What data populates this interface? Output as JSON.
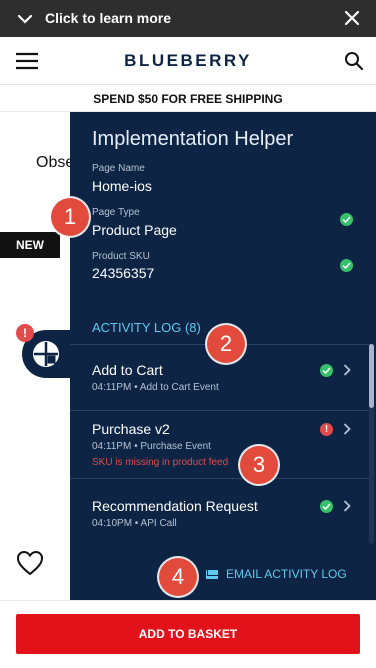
{
  "banner": {
    "text": "Click to learn more"
  },
  "header": {
    "brand": "BLUEBERRY"
  },
  "promo": {
    "text": "SPEND $50 FOR FREE SHIPPING"
  },
  "background": {
    "text": "Obse",
    "badge": "NEW"
  },
  "panel": {
    "title": "Implementation Helper",
    "fields": [
      {
        "label": "Page Name",
        "value": "Home-ios"
      },
      {
        "label": "Page Type",
        "value": "Product Page"
      },
      {
        "label": "Product SKU",
        "value": "24356357"
      }
    ],
    "activity_log_title": "ACTIVITY LOG (8)",
    "log": [
      {
        "name": "Add to Cart",
        "time": "04:11PM",
        "event": "Add to Cart Event",
        "status": "ok"
      },
      {
        "name": "Purchase v2",
        "time": "04:11PM",
        "event": "Purchase Event",
        "status": "error",
        "error": "SKU is missing in product feed"
      },
      {
        "name": "Recommendation Request",
        "time": "04:10PM",
        "event": "API Call",
        "status": "ok"
      }
    ],
    "email_label": "EMAIL ACTIVITY LOG"
  },
  "markers": [
    "1",
    "2",
    "3",
    "4"
  ],
  "footer": {
    "add_to_basket": "ADD TO BASKET"
  },
  "colors": {
    "panel": "#0d2444",
    "accent": "#5fc9ef",
    "ok": "#35c06a",
    "error": "#e24b4b",
    "cta": "#e3121a"
  }
}
